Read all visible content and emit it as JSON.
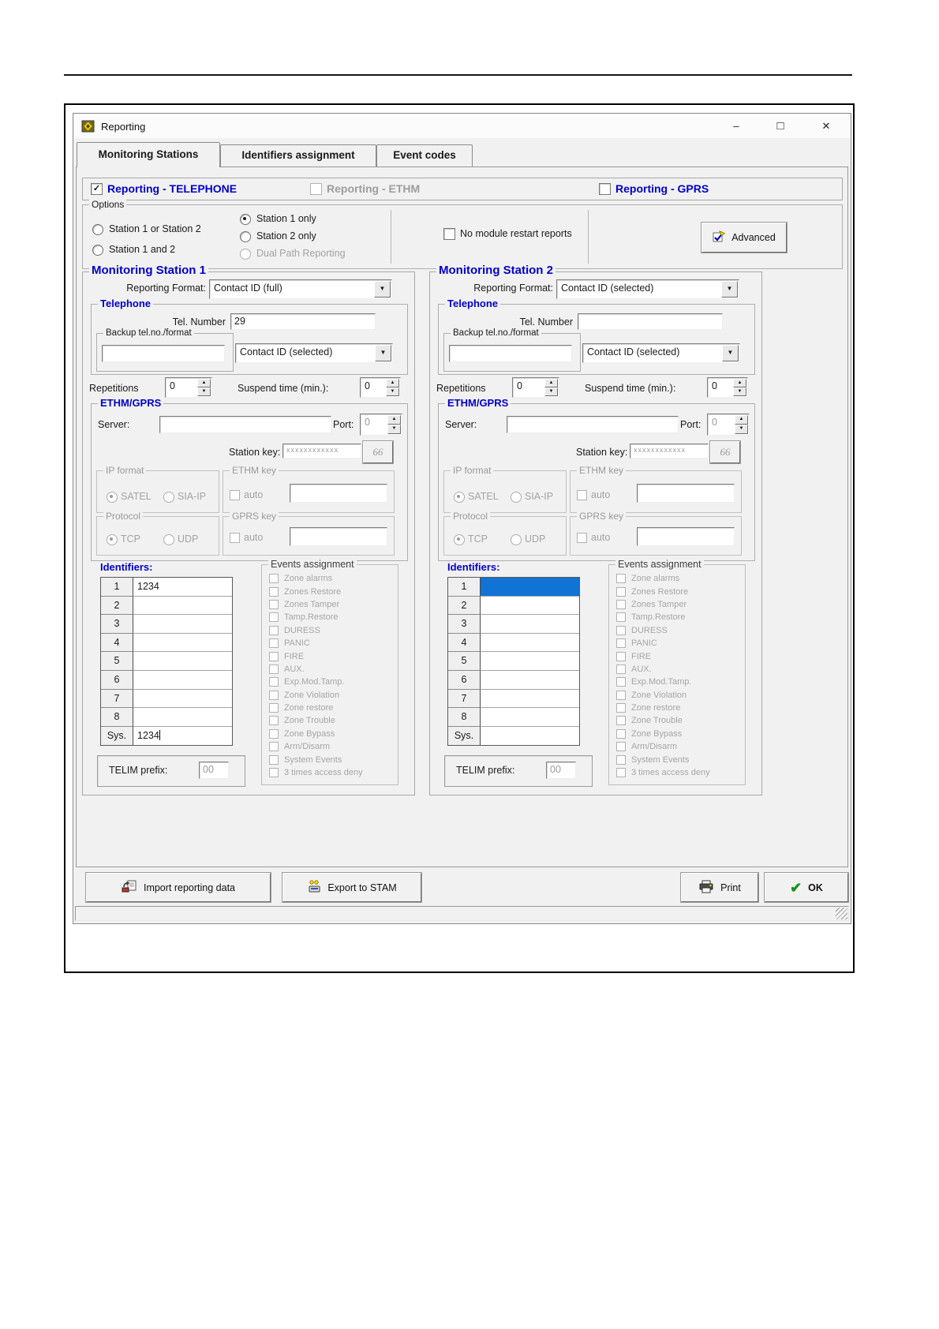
{
  "window": {
    "title": "Reporting"
  },
  "icons": {
    "minimize": "–",
    "maximize": "□",
    "close": "✕",
    "combo_arrow": "▼",
    "spin_up": "▲",
    "spin_down": "▼",
    "glasses": "66",
    "ok_check": "✔",
    "checkbox_check": "✓"
  },
  "tabs": [
    {
      "label": "Monitoring Stations",
      "active": true
    },
    {
      "label": "Identifiers assignment",
      "active": false
    },
    {
      "label": "Event codes",
      "active": false
    }
  ],
  "modes": [
    {
      "label": "Reporting - TELEPHONE",
      "checked": true,
      "enabled": true
    },
    {
      "label": "Reporting - ETHM",
      "checked": false,
      "enabled": false
    },
    {
      "label": "Reporting - GPRS",
      "checked": false,
      "enabled": true
    }
  ],
  "options": {
    "title": "Options",
    "station_1_or_2": "Station 1 or Station 2",
    "station_1_and_2": "Station 1 and 2",
    "station_1_only": "Station 1 only",
    "station_2_only": "Station 2 only",
    "dual_path": "Dual Path Reporting",
    "no_restart": "No module restart reports",
    "advanced": "Advanced"
  },
  "labels": {
    "reporting_format": "Reporting Format:",
    "telephone": "Telephone",
    "tel_number": "Tel. Number",
    "backup": "Backup tel.no./format",
    "repetitions": "Repetitions",
    "suspend_time": "Suspend time (min.):",
    "ethm_gprs": "ETHM/GPRS",
    "server": "Server:",
    "port": "Port:",
    "station_key": "Station key:",
    "ip_format": "IP format",
    "satel": "SATEL",
    "sia_ip": "SIA-IP",
    "ethm_key": "ETHM key",
    "auto": "auto",
    "protocol": "Protocol",
    "tcp": "TCP",
    "udp": "UDP",
    "gprs_key": "GPRS key",
    "identifiers": "Identifiers:",
    "telim_prefix": "TELIM prefix:",
    "events_assignment": "Events assignment"
  },
  "stations": [
    {
      "title": "Monitoring Station 1",
      "reporting_format": "Contact ID (full)",
      "tel_number": "29",
      "backup_tel": "",
      "backup_format": "Contact ID (selected)",
      "repetitions": "0",
      "suspend_time": "0",
      "server": "",
      "port": "0",
      "station_key": "xxxxxxxxxxxx",
      "ethm_key_value": "",
      "gprs_key_value": "",
      "telim": "00",
      "identifiers": [
        {
          "no": "1",
          "value": "1234"
        },
        {
          "no": "2",
          "value": ""
        },
        {
          "no": "3",
          "value": ""
        },
        {
          "no": "4",
          "value": ""
        },
        {
          "no": "5",
          "value": ""
        },
        {
          "no": "6",
          "value": ""
        },
        {
          "no": "7",
          "value": ""
        },
        {
          "no": "8",
          "value": ""
        },
        {
          "no": "Sys.",
          "value": "1234",
          "caret": true
        }
      ]
    },
    {
      "title": "Monitoring Station 2",
      "reporting_format": "Contact ID (selected)",
      "tel_number": "",
      "backup_tel": "",
      "backup_format": "Contact ID (selected)",
      "repetitions": "0",
      "suspend_time": "0",
      "server": "",
      "port": "0",
      "station_key": "xxxxxxxxxxxx",
      "ethm_key_value": "",
      "gprs_key_value": "",
      "telim": "00",
      "identifiers": [
        {
          "no": "1",
          "value": "",
          "selected": true
        },
        {
          "no": "2",
          "value": ""
        },
        {
          "no": "3",
          "value": ""
        },
        {
          "no": "4",
          "value": ""
        },
        {
          "no": "5",
          "value": ""
        },
        {
          "no": "6",
          "value": ""
        },
        {
          "no": "7",
          "value": ""
        },
        {
          "no": "8",
          "value": ""
        },
        {
          "no": "Sys.",
          "value": ""
        }
      ]
    }
  ],
  "events_list": [
    "Zone alarms",
    "Zones Restore",
    "Zones Tamper",
    "Tamp.Restore",
    "DURESS",
    "PANIC",
    "FIRE",
    "AUX.",
    "Exp.Mod.Tamp.",
    "Zone Violation",
    "Zone restore",
    "Zone Trouble",
    "Zone Bypass",
    "Arm/Disarm",
    "System Events",
    "3 times access deny"
  ],
  "footer": {
    "import": "Import reporting data",
    "export": "Export to STAM",
    "print": "Print",
    "ok": "OK"
  },
  "colors": {
    "accent_blue": "#0000cc",
    "selection_blue": "#1173d4",
    "ok_green": "#169416"
  }
}
